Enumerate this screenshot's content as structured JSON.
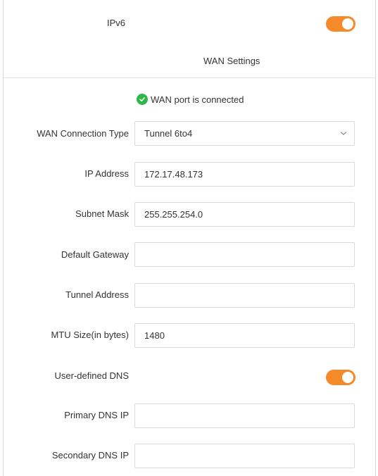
{
  "ipv6": {
    "label": "IPv6",
    "enabled": true
  },
  "wan_settings": {
    "title": "WAN Settings",
    "status_text": "WAN port is connected",
    "connection_type": {
      "label": "WAN Connection Type",
      "value": "Tunnel 6to4"
    },
    "ip_address": {
      "label": "IP Address",
      "value": "172.17.48.173"
    },
    "subnet_mask": {
      "label": "Subnet Mask",
      "value": "255.255.254.0"
    },
    "default_gateway": {
      "label": "Default Gateway",
      "value": ""
    },
    "tunnel_address": {
      "label": "Tunnel Address",
      "value": ""
    },
    "mtu": {
      "label": "MTU Size(in bytes)",
      "value": "1480"
    },
    "user_defined_dns": {
      "label": "User-defined DNS",
      "enabled": true
    },
    "primary_dns": {
      "label": "Primary DNS IP",
      "value": ""
    },
    "secondary_dns": {
      "label": "Secondary DNS IP",
      "value": ""
    }
  },
  "colors": {
    "accent": "#f58a2b",
    "success": "#2fb74a",
    "border": "#d9d9d9"
  }
}
